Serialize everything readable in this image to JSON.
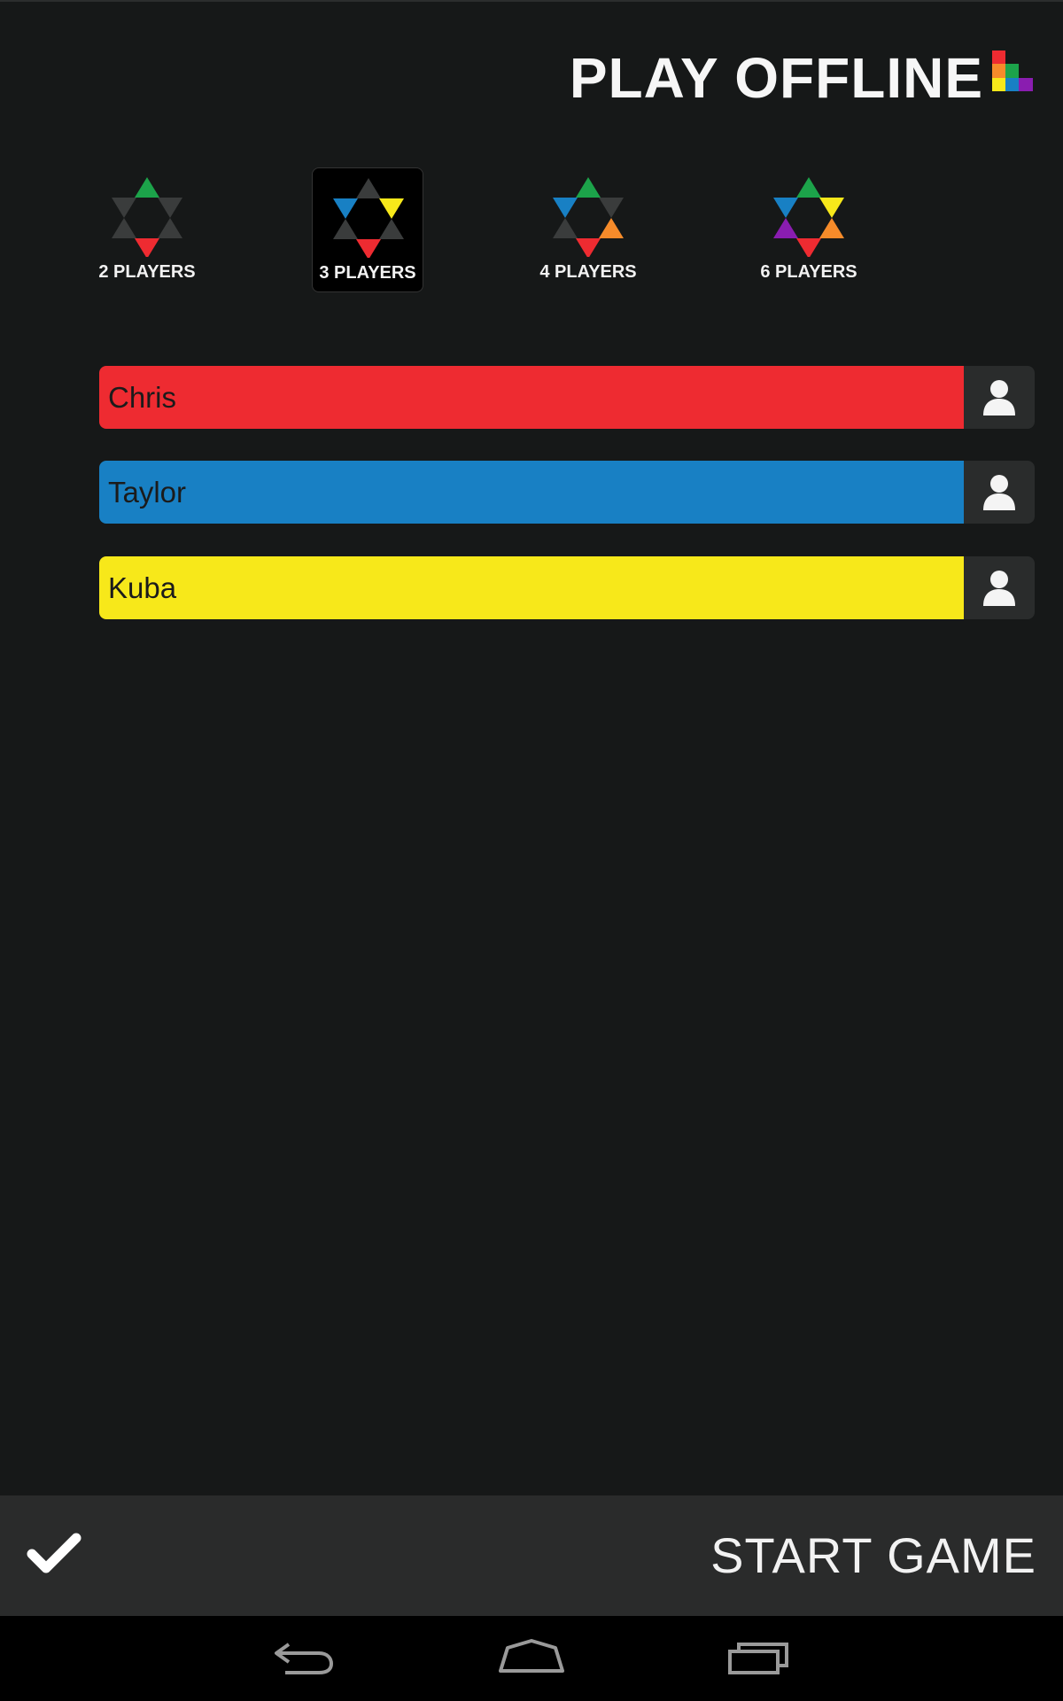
{
  "header": {
    "title": "PLAY OFFLINE"
  },
  "player_options": [
    {
      "label": "2 PLAYERS",
      "selected": false
    },
    {
      "label": "3 PLAYERS",
      "selected": true
    },
    {
      "label": "4 PLAYERS",
      "selected": false
    },
    {
      "label": "6 PLAYERS",
      "selected": false
    }
  ],
  "players": [
    {
      "name": "Chris",
      "color": "#ee2b31"
    },
    {
      "name": "Taylor",
      "color": "#1880c4"
    },
    {
      "name": "Kuba",
      "color": "#f7e81a"
    }
  ],
  "action_bar": {
    "start_label": "START GAME"
  },
  "icons": {
    "logo": "logo-icon",
    "avatar": "user-icon",
    "confirm": "check-icon",
    "back": "back-icon",
    "home": "home-icon",
    "recents": "recents-icon"
  },
  "colors": {
    "background": "#161818",
    "inactive_triangle": "#3a3c3c",
    "green": "#1ca34a",
    "red": "#ee2b31",
    "blue": "#1880c4",
    "yellow": "#f7e81a",
    "orange": "#f68b2a",
    "purple": "#8a1db0"
  }
}
